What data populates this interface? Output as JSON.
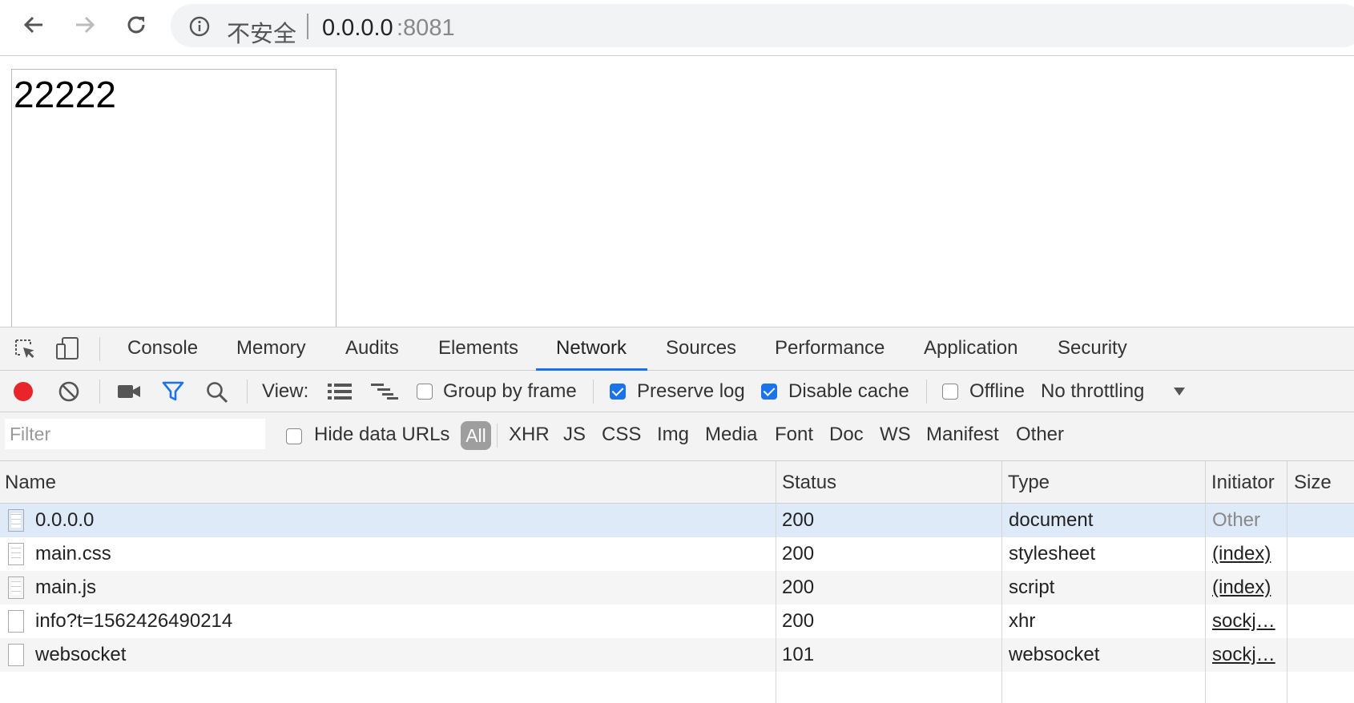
{
  "browser": {
    "security_label": "不安全",
    "url_host": "0.0.0.0",
    "url_port": ":8081"
  },
  "page": {
    "content": "22222"
  },
  "devtools": {
    "tabs": [
      "Console",
      "Memory",
      "Audits",
      "Elements",
      "Network",
      "Sources",
      "Performance",
      "Application",
      "Security"
    ],
    "active_tab": "Network",
    "toolbar": {
      "view_label": "View:",
      "group_by_frame": {
        "label": "Group by frame",
        "checked": false
      },
      "preserve_log": {
        "label": "Preserve log",
        "checked": true
      },
      "disable_cache": {
        "label": "Disable cache",
        "checked": true
      },
      "offline": {
        "label": "Offline",
        "checked": false
      },
      "throttling": "No throttling"
    },
    "filter": {
      "placeholder": "Filter",
      "hide_data_urls": {
        "label": "Hide data URLs",
        "checked": false
      },
      "all_label": "All",
      "types": [
        "XHR",
        "JS",
        "CSS",
        "Img",
        "Media",
        "Font",
        "Doc",
        "WS",
        "Manifest",
        "Other"
      ]
    },
    "table": {
      "headers": {
        "name": "Name",
        "status": "Status",
        "type": "Type",
        "initiator": "Initiator",
        "size": "Size"
      },
      "rows": [
        {
          "name": "0.0.0.0",
          "status": "200",
          "type": "document",
          "initiator": "Other"
        },
        {
          "name": "main.css",
          "status": "200",
          "type": "stylesheet",
          "initiator": "(index)"
        },
        {
          "name": "main.js",
          "status": "200",
          "type": "script",
          "initiator": "(index)"
        },
        {
          "name": "info?t=1562426490214",
          "status": "200",
          "type": "xhr",
          "initiator": "sockj…"
        },
        {
          "name": "websocket",
          "status": "101",
          "type": "websocket",
          "initiator": "sockj…"
        }
      ]
    },
    "colors": {
      "accent": "#1a73e8",
      "record": "#e8252a",
      "selected_row": "#dfeaf9",
      "alt_row": "#f5f5f5"
    }
  }
}
